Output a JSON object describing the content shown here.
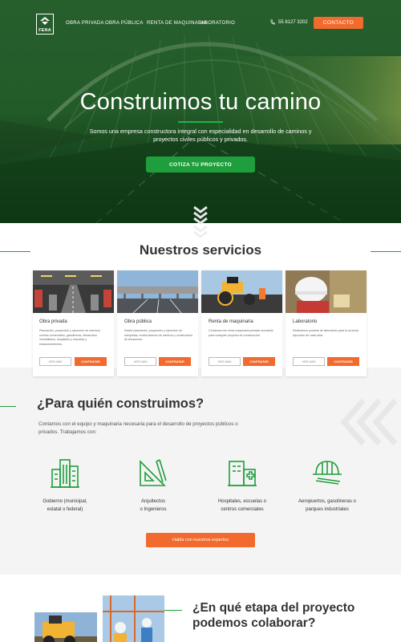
{
  "nav": {
    "logo_text": "FENA",
    "links": [
      "OBRA PRIVADA",
      "OBRA PÚBLICA",
      "RENTA DE MAQUINARIA",
      "LABORATORIO"
    ],
    "phone": "55 8127 3202",
    "contact_label": "CONTACTO"
  },
  "hero": {
    "title": "Construimos tu camino",
    "subtitle": "Somos una empresa constructora integral con especialidad en desarrollo de caminos y proyectos civiles públicos y privados.",
    "cta_label": "COTIZA TU PROYECTO"
  },
  "services": {
    "title": "Nuestros servicios",
    "cards": [
      {
        "title": "Obra privada",
        "desc": "Planeación, proyección y ejecución de caminos, centros comerciales, gasolineras, desarrollos inmobiliarios, hospitales y escuelas y estacionamientos.",
        "more_label": "VER MÁS",
        "contract_label": "CONTRATAR"
      },
      {
        "title": "Obra pública",
        "desc": "Desde planeación, proyección y ejecución de autopistas, modernización de caminos y construcción de terracerías.",
        "more_label": "VER MÁS",
        "contract_label": "CONTRATAR"
      },
      {
        "title": "Renta de maquinaria",
        "desc": "Contamos con renta maquinaria pesada necesaria para cualquier proyecto de construcción.",
        "more_label": "VER MÁS",
        "contract_label": "CONTRATAR"
      },
      {
        "title": "Laboratorio",
        "desc": "Realizamos pruebas de laboratorio para la correcta ejecución de cada obra.",
        "more_label": "VER MÁS",
        "contract_label": "CONTRATAR"
      }
    ]
  },
  "who": {
    "title": "¿Para quién construimos?",
    "desc": "Contamos con el equipo y maquinaria necesaria para el desarrollo de proyectos públicos o privados. Trabajamos con:",
    "items": [
      {
        "line1": "Gobierno (municipal,",
        "line2": "estatal o federal)",
        "icon": "buildings-icon"
      },
      {
        "line1": "Arquitectos",
        "line2": "o Ingenieros",
        "icon": "drafting-tools-icon"
      },
      {
        "line1": "Hospitales, escuelas o",
        "line2": "centros comerciales",
        "icon": "hospital-icon"
      },
      {
        "line1": "Aeropuertos, gasolineras o",
        "line2": "parques industriales",
        "icon": "hardhat-icon"
      }
    ],
    "cta_label": "Habla con nuestros expertos"
  },
  "stage": {
    "title_line1": "¿En qué etapa del proyecto",
    "title_line2": "podemos colaborar?"
  },
  "colors": {
    "green": "#1e9e3c",
    "orange": "#f26a2e",
    "dark_text": "#333333"
  }
}
